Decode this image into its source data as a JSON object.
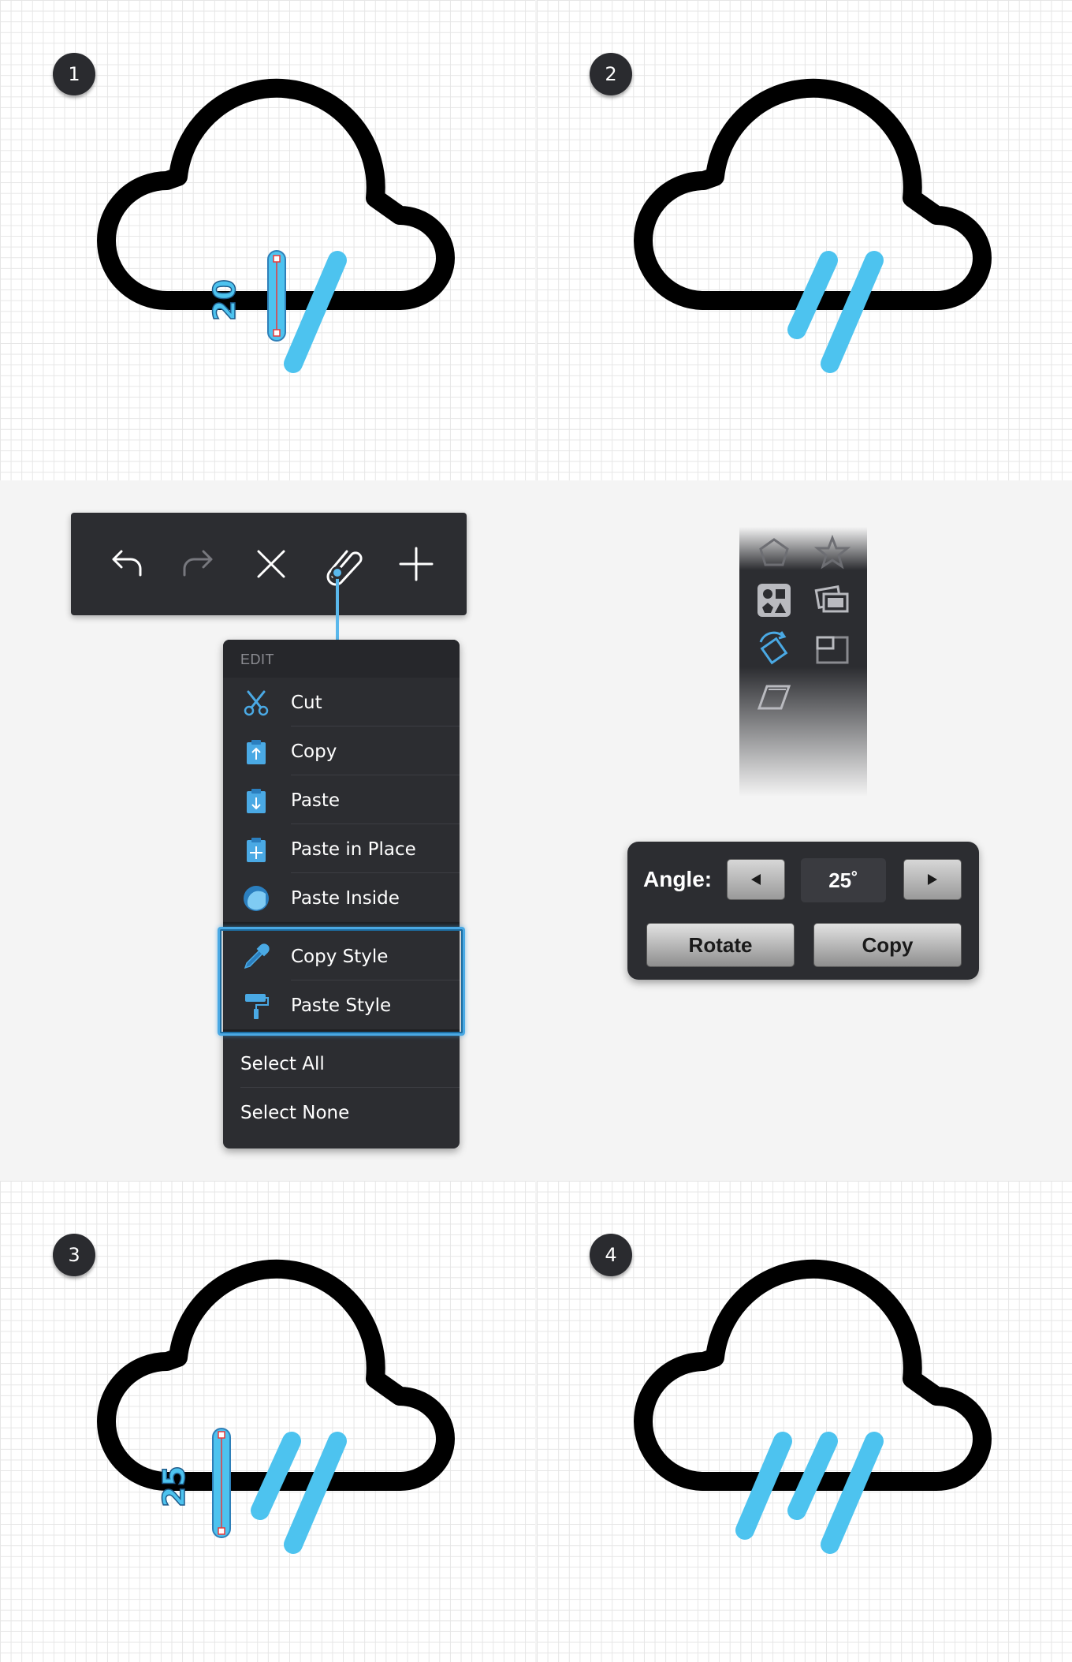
{
  "steps": {
    "step1": {
      "badge": "1",
      "dimension_label": "20"
    },
    "step2": {
      "badge": "2"
    },
    "step3": {
      "badge": "3",
      "dimension_label": "25"
    },
    "step4": {
      "badge": "4"
    }
  },
  "colors": {
    "cloud_stroke": "#000000",
    "rain": "#4dc3ef",
    "selection": "#4aa9e4",
    "panel_dark": "#2c2d31",
    "anchor_point": "#e83a3a"
  },
  "toolbar": {
    "buttons": [
      "undo-icon",
      "redo-icon",
      "close-icon",
      "paperclip-icon",
      "plus-icon"
    ]
  },
  "edit_menu": {
    "header": "EDIT",
    "items": [
      {
        "label": "Cut",
        "icon": "scissors-icon"
      },
      {
        "label": "Copy",
        "icon": "clipboard-copy-icon"
      },
      {
        "label": "Paste",
        "icon": "clipboard-paste-icon"
      },
      {
        "label": "Paste in Place",
        "icon": "clipboard-paste-in-place-icon"
      },
      {
        "label": "Paste Inside",
        "icon": "paste-inside-icon"
      }
    ],
    "style_items": [
      {
        "label": "Copy Style",
        "icon": "eyedropper-icon"
      },
      {
        "label": "Paste Style",
        "icon": "paint-roller-icon"
      }
    ],
    "selection_items": [
      {
        "label": "Select All"
      },
      {
        "label": "Select None"
      }
    ]
  },
  "side_tools": [
    "pentagon-icon",
    "star-icon",
    "shapes-icon",
    "layers-icon",
    "rotate-icon",
    "scale-icon",
    "skew-icon"
  ],
  "angle_panel": {
    "label": "Angle:",
    "value": "25˚",
    "rotate_label": "Rotate",
    "copy_label": "Copy"
  }
}
